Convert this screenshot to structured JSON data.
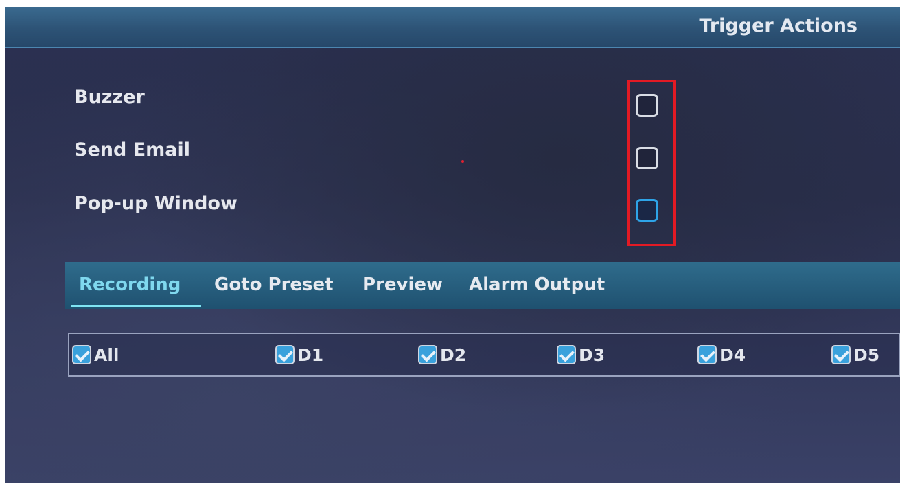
{
  "window": {
    "title": "Trigger Actions"
  },
  "trigger_actions": [
    {
      "label": "Buzzer",
      "checked": false
    },
    {
      "label": "Send Email",
      "checked": false
    },
    {
      "label": "Pop-up Window",
      "checked": false,
      "focused": true
    }
  ],
  "tabs": [
    {
      "label": "Recording",
      "active": true
    },
    {
      "label": "Goto Preset",
      "active": false
    },
    {
      "label": "Preview",
      "active": false
    },
    {
      "label": "Alarm Output",
      "active": false
    }
  ],
  "channels": [
    {
      "label": "All",
      "checked": true
    },
    {
      "label": "D1",
      "checked": true
    },
    {
      "label": "D2",
      "checked": true
    },
    {
      "label": "D3",
      "checked": true
    },
    {
      "label": "D4",
      "checked": true
    },
    {
      "label": "D5",
      "checked": true
    }
  ],
  "colors": {
    "highlight_border": "#e21a24",
    "focus_border": "#2ea4e8",
    "active_tab_text": "#7fd8ee",
    "checkbox_fill": "#3aa1dc"
  }
}
